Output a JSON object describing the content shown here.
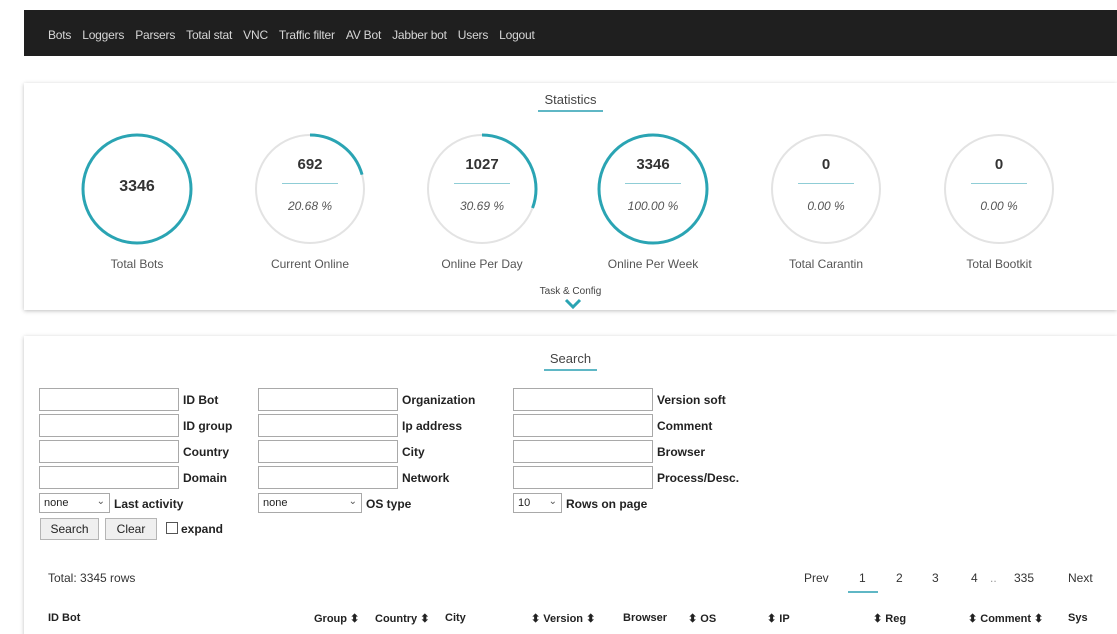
{
  "nav": {
    "items": [
      "Bots",
      "Loggers",
      "Parsers",
      "Total stat",
      "VNC",
      "Traffic filter",
      "AV Bot",
      "Jabber bot",
      "Users",
      "Logout"
    ]
  },
  "statistics": {
    "title": "Statistics",
    "accent_color": "#2aa4b3",
    "track_color": "#e3e3e3",
    "stats": [
      {
        "value": "3346",
        "label": "Total Bots",
        "percent": null,
        "fraction": 1.0
      },
      {
        "value": "692",
        "percent": "20.68 %",
        "label": "Current Online",
        "fraction": 0.2068
      },
      {
        "value": "1027",
        "percent": "30.69 %",
        "label": "Online Per Day",
        "fraction": 0.3069
      },
      {
        "value": "3346",
        "percent": "100.00 %",
        "label": "Online Per Week",
        "fraction": 1.0
      },
      {
        "value": "0",
        "percent": "0.00 %",
        "label": "Total Carantin",
        "fraction": 0.0
      },
      {
        "value": "0",
        "percent": "0.00 %",
        "label": "Total Bootkit",
        "fraction": 0.0
      }
    ],
    "task_config_label": "Task & Config",
    "task_config_icon": "chevron-down-icon"
  },
  "search": {
    "title": "Search",
    "labels": {
      "id_bot": "ID Bot",
      "id_group": "ID group",
      "country": "Country",
      "domain": "Domain",
      "organization": "Organization",
      "ip_address": "Ip address",
      "city": "City",
      "network": "Network",
      "version_soft": "Version soft",
      "comment": "Comment",
      "browser": "Browser",
      "process": "Process/Desc.",
      "last_activity": "Last activity",
      "os_type": "OS type",
      "rows_on_page": "Rows on page"
    },
    "selects": {
      "last_activity": "none",
      "os_type": "none",
      "rows_on_page": "10"
    },
    "buttons": {
      "search": "Search",
      "clear": "Clear"
    },
    "expand_label": "expand"
  },
  "results": {
    "total": "Total: 3345 rows",
    "pager": {
      "prev": "Prev",
      "pages": [
        "1",
        "2",
        "3",
        "4"
      ],
      "ellipsis": "..",
      "last": "335",
      "next": "Next",
      "current": "1"
    },
    "columns": [
      "ID Bot",
      "Group ⬍",
      "Country ⬍",
      "City",
      "⬍ Version ⬍",
      "Browser",
      "⬍ OS",
      "⬍ IP",
      "⬍ Reg",
      "⬍ Comment ⬍",
      "Sys"
    ]
  }
}
